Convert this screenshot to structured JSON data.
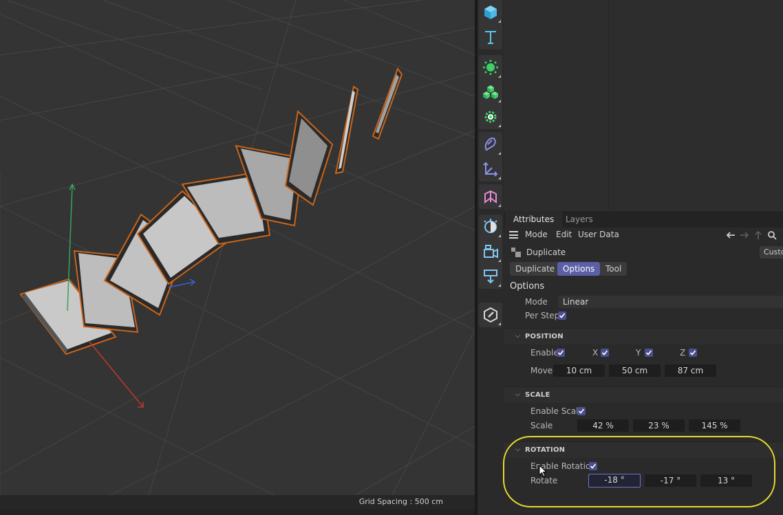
{
  "viewport": {
    "grid_spacing": "Grid Spacing : 500 cm"
  },
  "toolbar": {
    "buttons": [
      {
        "name": "cube-icon"
      },
      {
        "name": "text-icon"
      },
      {
        "name": "generator-icon"
      },
      {
        "name": "cloner-icon"
      },
      {
        "name": "gear-deformer-icon"
      },
      {
        "name": "spline-icon"
      },
      {
        "name": "axis-icon"
      },
      {
        "name": "mograph-effector-icon"
      },
      {
        "name": "light-icon"
      },
      {
        "name": "camera-icon"
      },
      {
        "name": "floor-icon"
      },
      {
        "name": "edit-tag-icon"
      }
    ]
  },
  "attributes": {
    "tabs": [
      "Attributes",
      "Layers"
    ],
    "menu": [
      "Mode",
      "Edit",
      "User Data"
    ],
    "object_name": "Duplicate",
    "custom_label": "Custo",
    "sub_tabs": [
      "Duplicate",
      "Options",
      "Tool"
    ],
    "active_sub_tab": "Options",
    "section_title": "Options",
    "mode_label": "Mode",
    "mode_value": "Linear",
    "per_step_label": "Per Step",
    "position": {
      "title": "POSITION",
      "enable_label": "Enable",
      "x_label": "X",
      "y_label": "Y",
      "z_label": "Z",
      "move_label": "Move",
      "move_values": [
        "10 cm",
        "50 cm",
        "87 cm"
      ]
    },
    "scale": {
      "title": "SCALE",
      "enable_label": "Enable Scale",
      "scale_label": "Scale",
      "scale_values": [
        "42 %",
        "23 %",
        "145 %"
      ]
    },
    "rotation": {
      "title": "ROTATION",
      "enable_label": "Enable Rotation",
      "rotate_label": "Rotate",
      "rotate_values": [
        "-18 °",
        "-17 °",
        "13 °"
      ]
    }
  },
  "colors": {
    "accent": "#5b5fa6",
    "selection_outline": "#c8651b",
    "highlight": "#e8dc2c",
    "axis_x": "#c0392b",
    "axis_y": "#3aa35a",
    "axis_z": "#3a5fd0"
  }
}
